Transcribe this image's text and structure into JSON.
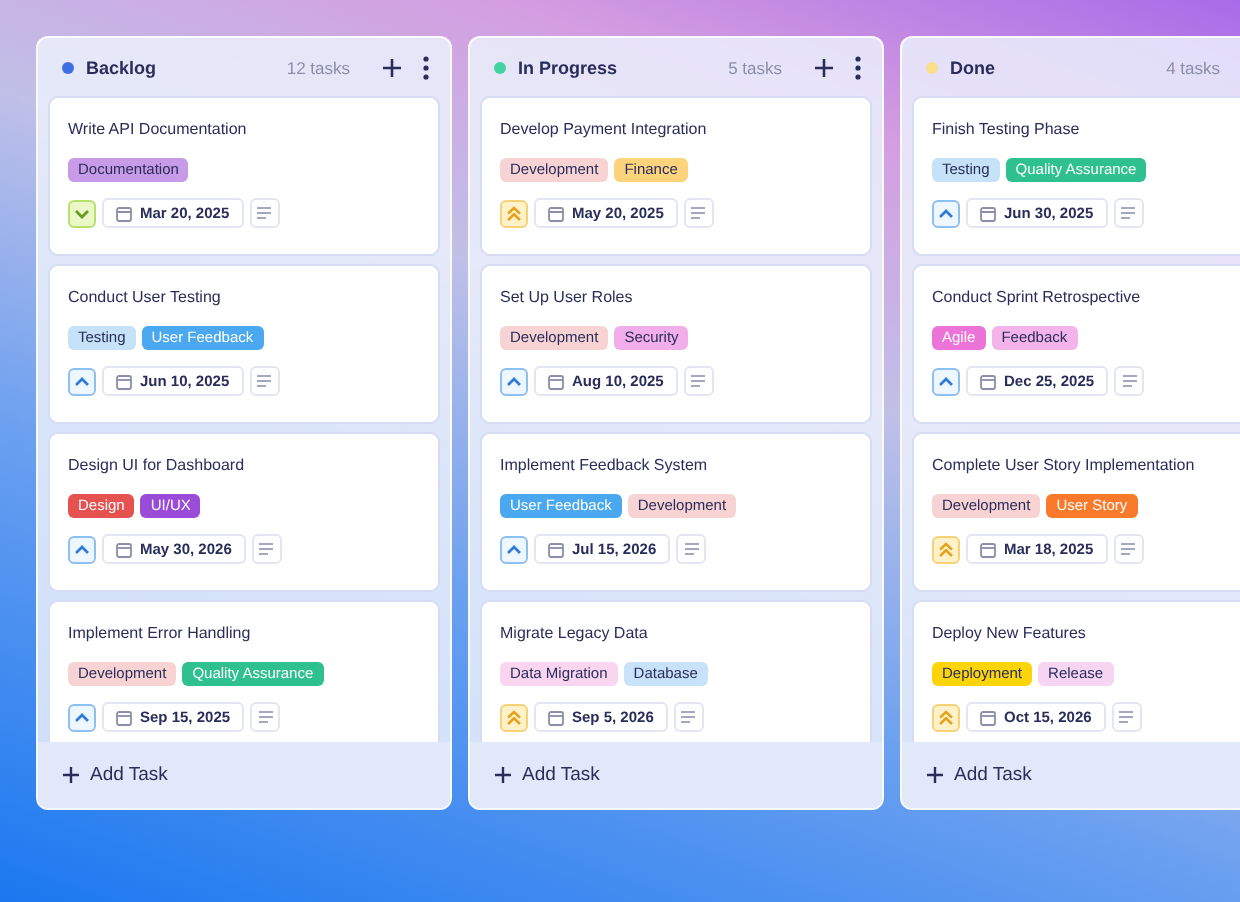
{
  "columns": [
    {
      "title": "Backlog",
      "color": "#3d6fe3",
      "count": "12 tasks",
      "actions_visible": true,
      "add_label": "Add Task",
      "cards": [
        {
          "title": "Write API Documentation",
          "kind": "low",
          "date": "Mar 20, 2025",
          "tags": [
            {
              "label": "Documentation",
              "color": "#c89be8"
            }
          ]
        },
        {
          "title": "Conduct User Testing",
          "kind": "medium",
          "date": "Jun 10, 2025",
          "tags": [
            {
              "label": "Testing",
              "color": "#c5e2f8"
            },
            {
              "label": "User Feedback",
              "color": "#4aa8f0"
            }
          ]
        },
        {
          "title": "Design UI for Dashboard",
          "kind": "medium",
          "date": "May 30, 2026",
          "tags": [
            {
              "label": "Design",
              "color": "#e5524f"
            },
            {
              "label": "UI/UX",
              "color": "#9a4bd8"
            }
          ]
        },
        {
          "title": "Implement Error Handling",
          "kind": "medium",
          "date": "Sep 15, 2025",
          "tags": [
            {
              "label": "Development",
              "color": "#f8d3d3"
            },
            {
              "label": "Quality Assurance",
              "color": "#2ec08f"
            }
          ]
        }
      ]
    },
    {
      "title": "In Progress",
      "color": "#45d3a4",
      "count": "5 tasks",
      "actions_visible": true,
      "add_label": "Add Task",
      "cards": [
        {
          "title": "Develop Payment Integration",
          "kind": "high",
          "date": "May 20, 2025",
          "tags": [
            {
              "label": "Development",
              "color": "#f8d3d3"
            },
            {
              "label": "Finance",
              "color": "#fdd47c"
            }
          ]
        },
        {
          "title": "Set Up User Roles",
          "kind": "medium",
          "date": "Aug 10, 2025",
          "tags": [
            {
              "label": "Development",
              "color": "#f8d3d3"
            },
            {
              "label": "Security",
              "color": "#f2aeea"
            }
          ]
        },
        {
          "title": "Implement Feedback System",
          "kind": "medium",
          "date": "Jul 15, 2026",
          "tags": [
            {
              "label": "User Feedback",
              "color": "#4aa8f0"
            },
            {
              "label": "Development",
              "color": "#f8d3d3"
            }
          ]
        },
        {
          "title": "Migrate Legacy Data",
          "kind": "high",
          "date": "Sep 5, 2026",
          "tags": [
            {
              "label": "Data Migration",
              "color": "#f9d5f0"
            },
            {
              "label": "Database",
              "color": "#c8e2f9"
            }
          ]
        }
      ]
    },
    {
      "title": "Done",
      "color": "#f8e08a",
      "count": "4 tasks",
      "actions_visible": false,
      "add_label": "Add Task",
      "cards": [
        {
          "title": "Finish Testing Phase",
          "kind": "medium",
          "date": "Jun 30, 2025",
          "tags": [
            {
              "label": "Testing",
              "color": "#c5e2f8"
            },
            {
              "label": "Quality Assurance",
              "color": "#2ec08f"
            }
          ]
        },
        {
          "title": "Conduct Sprint Retrospective",
          "kind": "medium",
          "date": "Dec 25, 2025",
          "tags": [
            {
              "label": "Agile",
              "color": "#ec74d8"
            },
            {
              "label": "Feedback",
              "color": "#f4b3ea"
            }
          ]
        },
        {
          "title": "Complete User Story Implementation",
          "kind": "high",
          "date": "Mar 18, 2025",
          "tags": [
            {
              "label": "Development",
              "color": "#f8d3d3"
            },
            {
              "label": "User Story",
              "color": "#f97a2a"
            }
          ]
        },
        {
          "title": "Deploy New Features",
          "kind": "high",
          "date": "Oct 15, 2026",
          "tags": [
            {
              "label": "Deployment",
              "color": "#fcd40a"
            },
            {
              "label": "Release",
              "color": "#f6d5f2"
            }
          ]
        }
      ]
    }
  ]
}
